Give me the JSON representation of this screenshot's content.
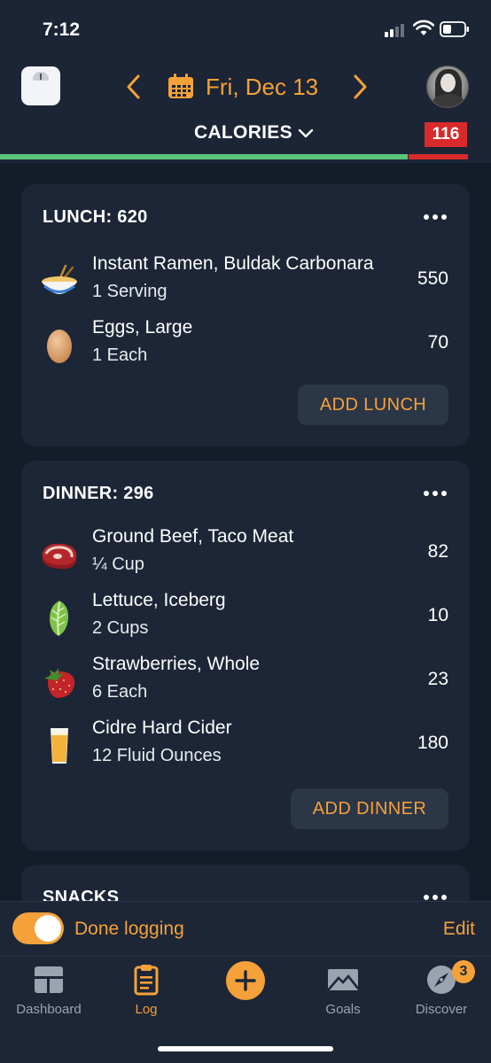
{
  "status_bar": {
    "time": "7:12"
  },
  "header": {
    "date": "Fri, Dec 13",
    "nutrient": "CALORIES",
    "over_amount": "116",
    "progress_fraction": 0.83,
    "colors": {
      "accent": "#f5a13a",
      "good": "#5bc57a",
      "over": "#d82a2a"
    }
  },
  "meals": [
    {
      "title": "LUNCH: 620",
      "add_label": "ADD LUNCH",
      "items": [
        {
          "icon": "ramen-bowl-icon",
          "name": "Instant Ramen, Buldak Carbonara",
          "serving": "1 Serving",
          "calories": "550"
        },
        {
          "icon": "egg-icon",
          "name": "Eggs, Large",
          "serving": "1 Each",
          "calories": "70"
        }
      ]
    },
    {
      "title": "DINNER: 296",
      "add_label": "ADD DINNER",
      "items": [
        {
          "icon": "steak-icon",
          "name": "Ground Beef, Taco Meat",
          "serving": "¼ Cup",
          "calories": "82"
        },
        {
          "icon": "lettuce-icon",
          "name": "Lettuce, Iceberg",
          "serving": "2 Cups",
          "calories": "10"
        },
        {
          "icon": "strawberry-icon",
          "name": "Strawberries, Whole",
          "serving": "6 Each",
          "calories": "23"
        },
        {
          "icon": "cider-glass-icon",
          "name": "Cidre Hard Cider",
          "serving": "12 Fluid Ounces",
          "calories": "180"
        }
      ]
    },
    {
      "title": "SNACKS"
    }
  ],
  "done_logging": {
    "label": "Done logging",
    "enabled": true,
    "edit_label": "Edit"
  },
  "tabs": [
    {
      "label": "Dashboard",
      "icon": "dashboard-icon",
      "active": false
    },
    {
      "label": "Log",
      "icon": "clipboard-icon",
      "active": true
    },
    {
      "label": "",
      "icon": "plus-icon",
      "active": false
    },
    {
      "label": "Goals",
      "icon": "envelope-icon",
      "active": false
    },
    {
      "label": "Discover",
      "icon": "compass-icon",
      "active": false,
      "badge": "3"
    }
  ]
}
